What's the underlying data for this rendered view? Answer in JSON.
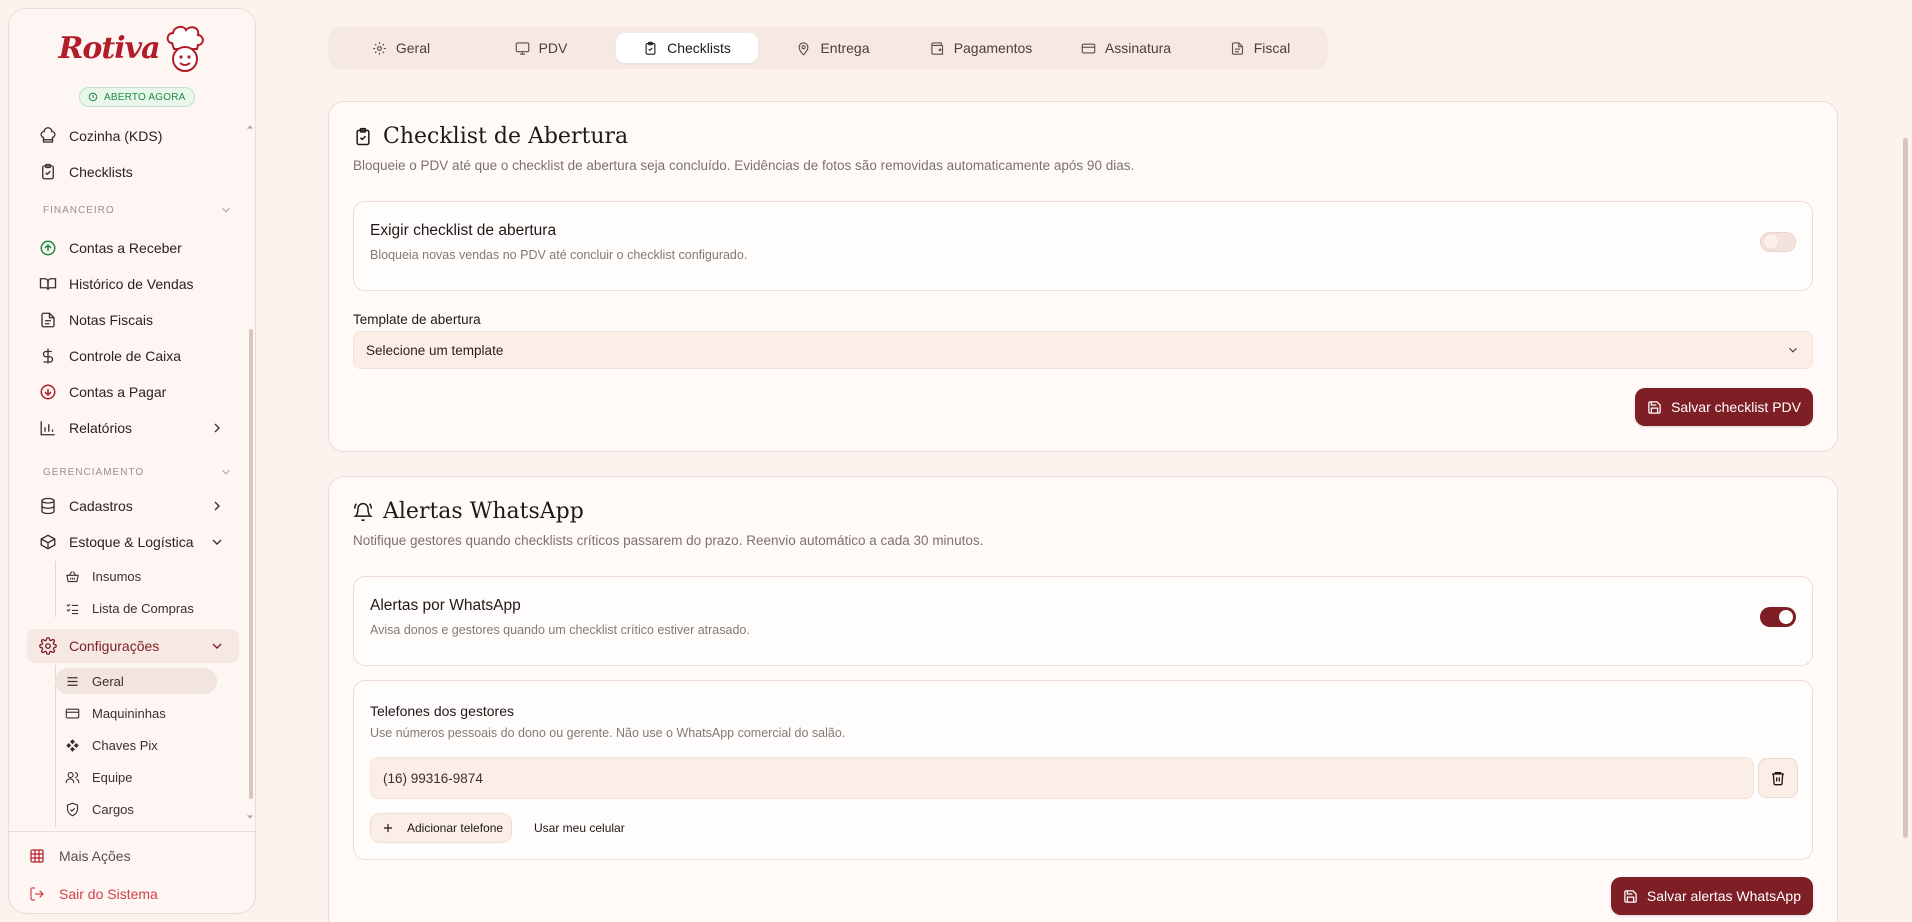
{
  "brand": {
    "name": "Rotiva",
    "status": "ABERTO AGORA",
    "accent_color": "#7d1f25",
    "logo_color": "#b21d2a",
    "status_color": "#1f8a45"
  },
  "sidebar": {
    "top_items": [
      {
        "label": "Cozinha (KDS)",
        "icon": "chef-hat-icon"
      },
      {
        "label": "Checklists",
        "icon": "clipboard-check-icon"
      }
    ],
    "sections": {
      "financeiro": "FINANCEIRO",
      "gerenciamento": "GERENCIAMENTO"
    },
    "financeiro_items": [
      {
        "label": "Contas a Receber",
        "icon": "arrow-up-circle-icon",
        "icon_color": "#1f8a45"
      },
      {
        "label": "Histórico de Vendas",
        "icon": "book-open-icon"
      },
      {
        "label": "Notas Fiscais",
        "icon": "file-text-icon"
      },
      {
        "label": "Controle de Caixa",
        "icon": "dollar-sign-icon"
      },
      {
        "label": "Contas a Pagar",
        "icon": "arrow-down-circle-icon",
        "icon_color": "#b21d2a"
      },
      {
        "label": "Relatórios",
        "icon": "bar-chart-icon"
      }
    ],
    "gerenciamento_items": [
      {
        "label": "Cadastros",
        "icon": "database-icon"
      },
      {
        "label": "Estoque & Logística",
        "icon": "package-icon"
      }
    ],
    "estoque_sub": [
      {
        "label": "Insumos",
        "icon": "basket-icon"
      },
      {
        "label": "Lista de Compras",
        "icon": "list-checks-icon"
      }
    ],
    "config": {
      "label": "Configurações",
      "icon": "gear-icon"
    },
    "config_sub": [
      {
        "label": "Geral",
        "icon": "menu-lines-icon"
      },
      {
        "label": "Maquininhas",
        "icon": "credit-card-icon"
      },
      {
        "label": "Chaves Pix",
        "icon": "pix-icon"
      },
      {
        "label": "Equipe",
        "icon": "users-icon"
      },
      {
        "label": "Cargos",
        "icon": "shield-check-icon"
      }
    ],
    "bottom": {
      "more_actions": "Mais Ações",
      "logout": "Sair do Sistema"
    }
  },
  "tabs": [
    {
      "label": "Geral",
      "icon": "gear-icon"
    },
    {
      "label": "PDV",
      "icon": "monitor-icon"
    },
    {
      "label": "Checklists",
      "icon": "clipboard-check-icon",
      "active": true
    },
    {
      "label": "Entrega",
      "icon": "map-pin-icon"
    },
    {
      "label": "Pagamentos",
      "icon": "wallet-icon"
    },
    {
      "label": "Assinatura",
      "icon": "credit-card-icon"
    },
    {
      "label": "Fiscal",
      "icon": "file-text-icon"
    }
  ],
  "checklist_card": {
    "title": "Checklist de Abertura",
    "description": "Bloqueie o PDV até que o checklist de abertura seja concluído. Evidências de fotos são removidas automaticamente após 90 dias.",
    "require_title": "Exigir checklist de abertura",
    "require_sub": "Bloqueia novas vendas no PDV até concluir o checklist configurado.",
    "require_enabled": false,
    "template_label": "Template de abertura",
    "template_placeholder": "Selecione um template",
    "save_label": "Salvar checklist PDV"
  },
  "whatsapp_card": {
    "title": "Alertas WhatsApp",
    "description": "Notifique gestores quando checklists críticos passarem do prazo. Reenvio automático a cada 30 minutos.",
    "alerts_title": "Alertas por WhatsApp",
    "alerts_sub": "Avisa donos e gestores quando um checklist crítico estiver atrasado.",
    "alerts_enabled": true,
    "phones_title": "Telefones dos gestores",
    "phones_sub": "Use números pessoais do dono ou gerente. Não use o WhatsApp comercial do salão.",
    "phone_value": "(16) 99316-9874",
    "add_phone_label": "Adicionar telefone",
    "use_my_phone_label": "Usar meu celular",
    "save_label": "Salvar alertas WhatsApp"
  }
}
